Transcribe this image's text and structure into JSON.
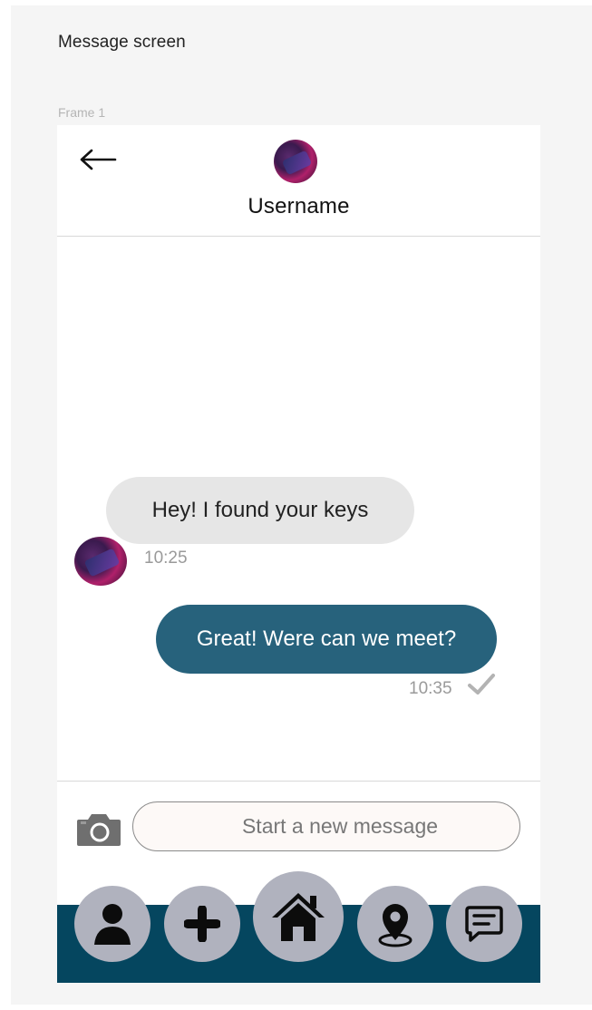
{
  "canvas": {
    "title": "Message screen",
    "frame_label": "Frame 1"
  },
  "header": {
    "username": "Username"
  },
  "messages": [
    {
      "direction": "incoming",
      "text": "Hey! I found your keys",
      "time": "10:25"
    },
    {
      "direction": "outgoing",
      "text": "Great! Were can we meet?",
      "time": "10:35",
      "status": "read"
    }
  ],
  "composer": {
    "placeholder": "Start a new message"
  },
  "nav": {
    "items": [
      {
        "icon": "person-icon"
      },
      {
        "icon": "plus-icon"
      },
      {
        "icon": "home-icon"
      },
      {
        "icon": "map-pin-icon"
      },
      {
        "icon": "chat-icon"
      }
    ]
  },
  "colors": {
    "outgoing_bubble": "#27627c",
    "incoming_bubble": "#e6e6e6",
    "nav_bar": "#05465f",
    "nav_button": "#b0b2be"
  }
}
